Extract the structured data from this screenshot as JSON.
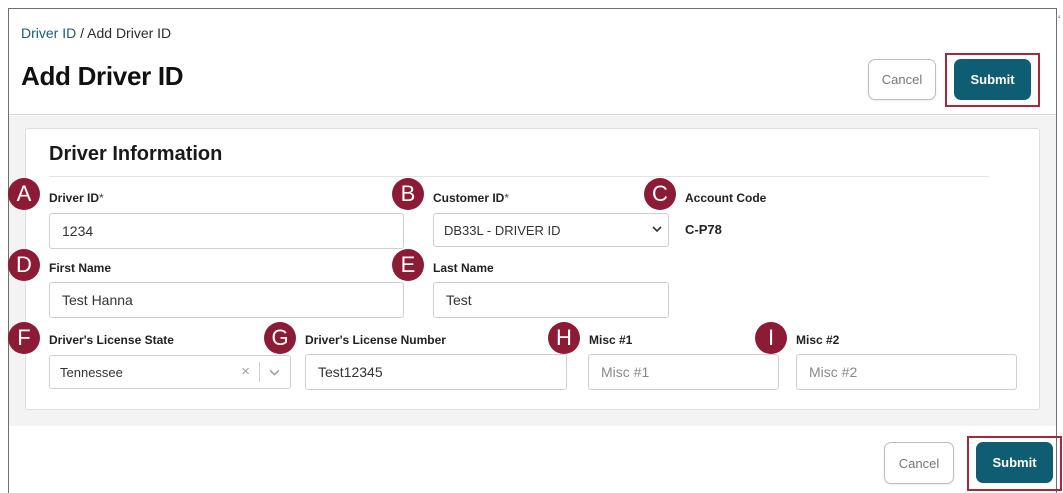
{
  "breadcrumb": {
    "parent": "Driver ID",
    "separator": " / ",
    "current": "Add Driver ID"
  },
  "page_title": "Add Driver ID",
  "header_actions": {
    "cancel_label": "Cancel",
    "submit_label": "Submit"
  },
  "section": {
    "title": "Driver Information"
  },
  "markers": [
    "A",
    "B",
    "C",
    "D",
    "E",
    "F",
    "G",
    "H",
    "I"
  ],
  "fields": {
    "driver_id": {
      "label": "Driver ID",
      "required_mark": "*",
      "value": "1234"
    },
    "customer_id": {
      "label": "Customer ID",
      "required_mark": "*",
      "selected": "DB33L - DRIVER ID"
    },
    "account_code": {
      "label": "Account Code",
      "value": "C-P78"
    },
    "first_name": {
      "label": "First Name",
      "value": "Test Hanna"
    },
    "last_name": {
      "label": "Last Name",
      "value": "Test"
    },
    "license_state": {
      "label": "Driver's License State",
      "selected": "Tennessee",
      "clear_glyph": "×"
    },
    "license_number": {
      "label": "Driver's License Number",
      "value": "Test12345"
    },
    "misc1": {
      "label": "Misc #1",
      "value": "",
      "placeholder": "Misc #1"
    },
    "misc2": {
      "label": "Misc #2",
      "value": "",
      "placeholder": "Misc #2"
    }
  },
  "footer_actions": {
    "cancel_label": "Cancel",
    "submit_label": "Submit"
  },
  "colors": {
    "primary": "#0f5d72",
    "marker": "#8c1c35",
    "highlight": "#a8283a",
    "link": "#1b5d73"
  }
}
